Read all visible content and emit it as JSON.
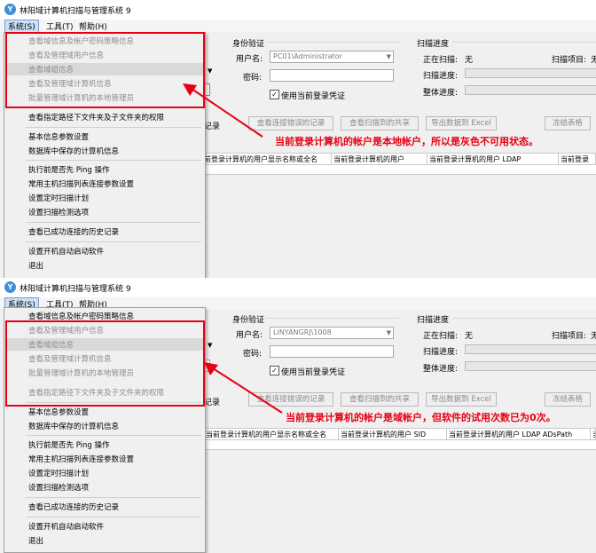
{
  "accent_red": "#e60012",
  "screens": [
    {
      "title": "林阳域计算机扫描与管理系统 9",
      "menubar": {
        "system": "系统(S)",
        "tools": "工具(T)",
        "help": "帮助(H)"
      },
      "menu_items": [
        {
          "label": "查看域信息及帐户密码策略信息",
          "disabled": true
        },
        {
          "label": "查看及管理域用户信息",
          "disabled": true
        },
        {
          "label": "查看域组信息",
          "disabled": true,
          "highlighted": true
        },
        {
          "label": "查看及管理域计算机信息",
          "disabled": true
        },
        {
          "label": "批量管理域计算机的本地管理员",
          "disabled": true
        },
        {
          "label": "查看指定路径下文件夹及子文件夹的权限",
          "disabled": false
        },
        {
          "label": "基本信息参数设置",
          "disabled": false
        },
        {
          "label": "数据库中保存的计算机信息",
          "disabled": false
        },
        {
          "label": "执行前是否先 Ping 操作",
          "disabled": false
        },
        {
          "label": "常用主机扫描列表连接参数设置",
          "disabled": false
        },
        {
          "label": "设置定时扫描计划",
          "disabled": false
        },
        {
          "label": "设置扫描检测选项",
          "disabled": false
        },
        {
          "label": "查看已成功连接的历史记录",
          "disabled": false
        },
        {
          "label": "设置开机自动启动软件",
          "disabled": false
        },
        {
          "label": "退出",
          "disabled": false
        }
      ],
      "auth": {
        "group_label": "身份验证",
        "username_label": "用户名:",
        "username_value": "PC01\\Administrator",
        "password_label": "密码:",
        "use_current_label": "使用当前登录凭证",
        "use_current_checked": true
      },
      "scan": {
        "group_label": "扫描进度",
        "scanning_label": "正在扫描:",
        "scanning_value": "无",
        "scan_item_label": "扫描项目:",
        "scan_item_value": "无",
        "scan_progress_label": "扫描进度:",
        "overall_progress_label": "整体进度:"
      },
      "records_label": "记录",
      "buttons": [
        "查看连接错误的记录",
        "查看扫描到的共享",
        "导出数据到 Excel",
        "冻结表格"
      ],
      "columns": [
        "前登录计算机的用户显示名称或全名",
        "当前登录计算机的用户",
        "当前登录计算机的用户 LDAP",
        "当前登录"
      ],
      "annotation": "当前登录计算机的帐户是本地帐户，所以是灰色不可用状态。"
    },
    {
      "title": "林阳域计算机扫描与管理系统 9",
      "menubar": {
        "system": "系统(S)",
        "tools": "工具(T)",
        "help": "帮助(H)"
      },
      "menu_items": [
        {
          "label": "查看域信息及帐户密码策略信息",
          "disabled": false
        },
        {
          "label": "查看及管理域用户信息",
          "disabled": true
        },
        {
          "label": "查看域组信息",
          "disabled": true,
          "highlighted": true
        },
        {
          "label": "查看及管理域计算机信息",
          "disabled": true
        },
        {
          "label": "批量管理域计算机的本地管理员",
          "disabled": true
        },
        {
          "label": "查看指定路径下文件夹及子文件夹的权限",
          "disabled": true
        },
        {
          "label": "基本信息参数设置",
          "disabled": false
        },
        {
          "label": "数据库中保存的计算机信息",
          "disabled": false
        },
        {
          "label": "执行前是否先 Ping 操作",
          "disabled": false
        },
        {
          "label": "常用主机扫描列表连接参数设置",
          "disabled": false
        },
        {
          "label": "设置定时扫描计划",
          "disabled": false
        },
        {
          "label": "设置扫描检测选项",
          "disabled": false
        },
        {
          "label": "查看已成功连接的历史记录",
          "disabled": false
        },
        {
          "label": "设置开机自动启动软件",
          "disabled": false
        },
        {
          "label": "退出",
          "disabled": false
        }
      ],
      "auth": {
        "group_label": "身份验证",
        "username_label": "用户名:",
        "username_value": "LINYANGRJ\\1008",
        "password_label": "密码:",
        "use_current_label": "使用当前登录凭证",
        "use_current_checked": true
      },
      "scan": {
        "group_label": "扫描进度",
        "scanning_label": "正在扫描:",
        "scanning_value": "无",
        "scan_item_label": "扫描项目:",
        "scan_item_value": "无",
        "scan_progress_label": "扫描进度:",
        "overall_progress_label": "整体进度:"
      },
      "records_label": "记录",
      "buttons": [
        "查看连接错误的记录",
        "查看扫描到的共享",
        "导出数据到 Excel",
        "冻结表格"
      ],
      "columns": [
        "当前登录计算机的用户显示名称或全名",
        "当前登录计算机的用户 SID",
        "当前登录计算机的用户 LDAP ADsPath",
        "当"
      ],
      "annotation": "当前登录计算机的帐户是域帐户，但软件的试用次数已为0次。"
    }
  ]
}
